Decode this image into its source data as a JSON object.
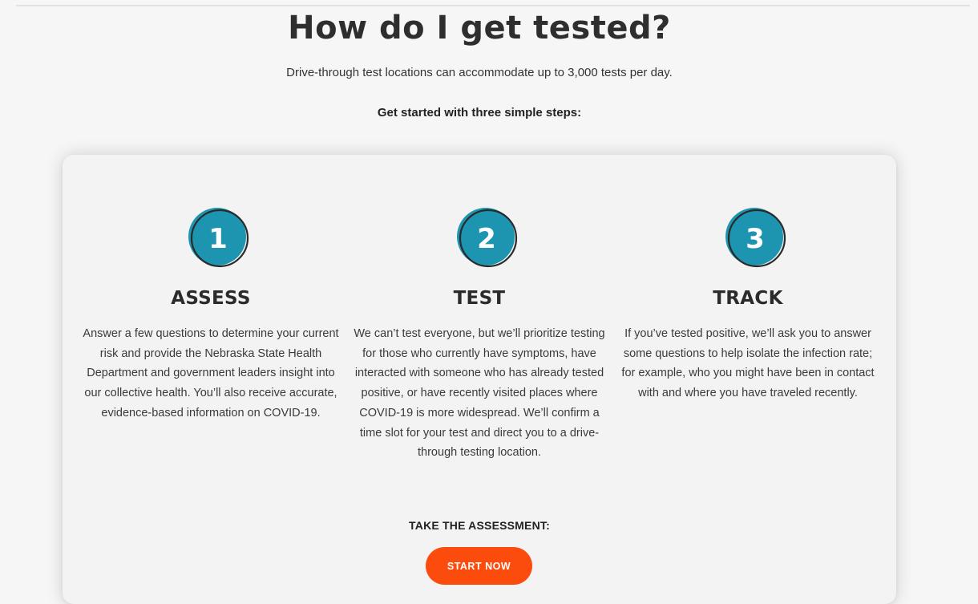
{
  "header": {
    "title": "How do I get tested?",
    "subtitle": "Drive-through test locations can accommodate up to 3,000 tests per day.",
    "steps_intro": "Get started with three simple steps:"
  },
  "colors": {
    "badge": "#1e95b0",
    "badge_outline": "#2a2a2a",
    "button": "#fc4c0d",
    "background": "#f6f6f6",
    "card": "#f3f3f3"
  },
  "steps": [
    {
      "number": "1",
      "heading": "ASSESS",
      "body": "Answer a few questions to determine your current risk and provide the Nebraska State Health Department and government leaders insight into our collective health. You’ll also receive accurate, evidence-based information on COVID-19."
    },
    {
      "number": "2",
      "heading": "TEST",
      "body": "We can’t test everyone, but we’ll prioritize testing for those who currently have symptoms, have interacted with someone who has already tested positive, or have recently visited places where COVID-19 is more widespread. We’ll confirm a time slot for your test and direct you to a drive-through testing location."
    },
    {
      "number": "3",
      "heading": "TRACK",
      "body": "If you’ve tested positive, we’ll ask you to answer some questions to help isolate the infection rate; for example, who you might have been in contact with and where you have traveled recently."
    }
  ],
  "cta": {
    "label": "TAKE THE ASSESSMENT:",
    "button_label": "START NOW"
  }
}
